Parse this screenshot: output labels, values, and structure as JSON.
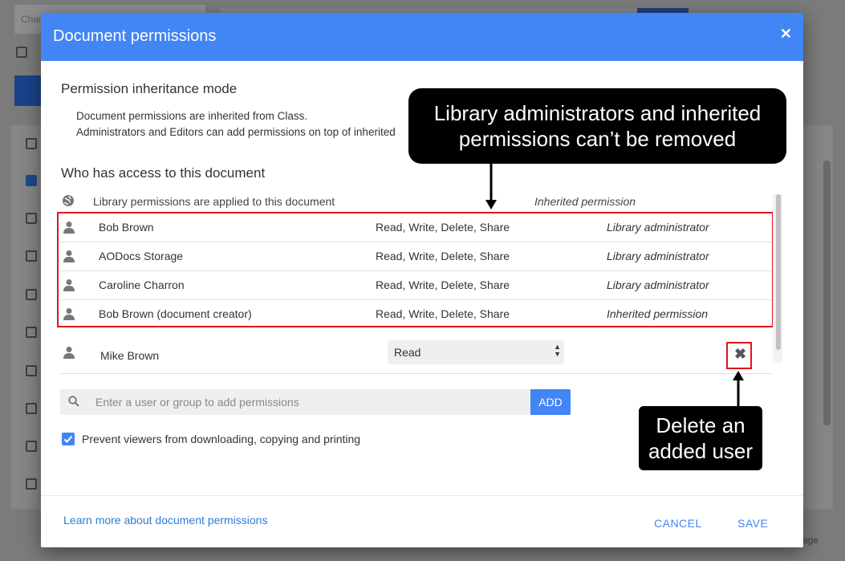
{
  "background": {
    "search_snippet": "Char"
  },
  "dialog": {
    "title": "Document permissions",
    "close_icon": "close-icon",
    "inheritance": {
      "heading": "Permission inheritance mode",
      "line1": "Document permissions are inherited from Class.",
      "line2": "Administrators and Editors can add permissions on top of inherited"
    },
    "access": {
      "heading": "Who has access to this document",
      "library_row": {
        "icon": "globe-icon",
        "text": "Library permissions are applied to this document",
        "source": "Inherited permission"
      },
      "rows": [
        {
          "name": "Bob Brown",
          "permissions": "Read, Write, Delete, Share",
          "source": "Library administrator"
        },
        {
          "name": "AODocs Storage",
          "permissions": "Read, Write, Delete, Share",
          "source": "Library administrator"
        },
        {
          "name": "Caroline Charron",
          "permissions": "Read, Write, Delete, Share",
          "source": "Library administrator"
        },
        {
          "name": "Bob Brown (document creator)",
          "permissions": "Read, Write, Delete, Share",
          "source": "Inherited permission"
        }
      ],
      "added_user": {
        "name": "Mike Brown",
        "permission_value": "Read"
      }
    },
    "search": {
      "placeholder": "Enter a user or group to add permissions",
      "add_label": "ADD"
    },
    "prevent_checkbox": {
      "checked": true,
      "label": "Prevent viewers from downloading, copying and printing"
    },
    "footer": {
      "learn_link": "Learn more about document permissions",
      "cancel_label": "CANCEL",
      "save_label": "SAVE"
    }
  },
  "annotations": {
    "callout_top": [
      "Library administrators and inherited",
      "permissions can’t be removed"
    ],
    "callout_bottom": [
      "Delete an",
      "added user"
    ]
  },
  "colors": {
    "header": "#4285f4",
    "highlight_border": "#e0141b",
    "callout_bg": "#000000"
  }
}
